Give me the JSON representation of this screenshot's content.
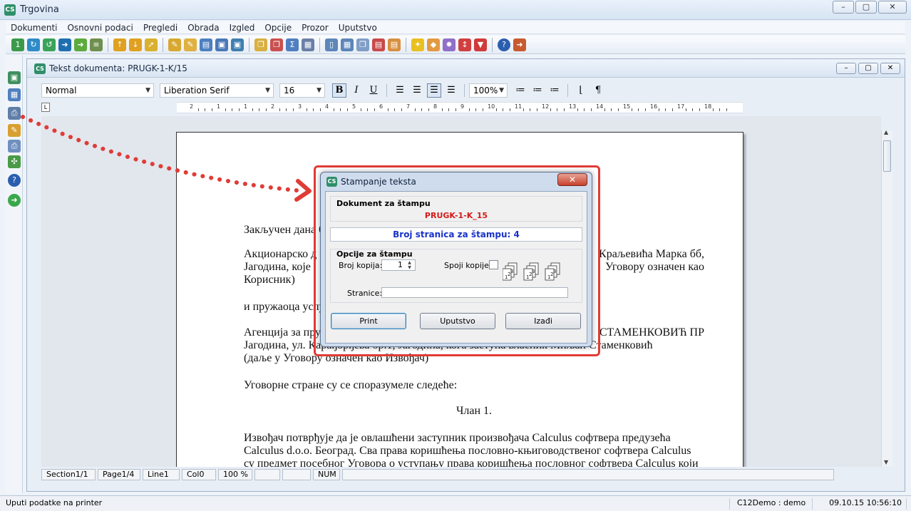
{
  "app": {
    "title": "Trgovina",
    "logo_text": "CS",
    "window_buttons": [
      "–",
      "▢",
      "✕"
    ]
  },
  "menu": [
    "Dokumenti",
    "Osnovni podaci",
    "Pregledi",
    "Obrada",
    "Izgled",
    "Opcije",
    "Prozor",
    "Uputstvo"
  ],
  "document_window": {
    "title": "Tekst dokumenta: PRUGK-1-K/15",
    "buttons": [
      "–",
      "▢",
      "✕"
    ]
  },
  "format_bar": {
    "style": "Normal",
    "font": "Liberation Serif",
    "size": "16",
    "zoom": "100%",
    "bold": "B",
    "italic": "I",
    "underline": "U",
    "paragraph_mark": "¶"
  },
  "ruler": {
    "tab_marker": "L",
    "labels": [
      "2",
      "1",
      "1",
      "2",
      "3",
      "4",
      "5",
      "6",
      "7",
      "8",
      "9",
      "10",
      "11",
      "12",
      "13",
      "14",
      "15",
      "16",
      "17",
      "18"
    ]
  },
  "document_text": {
    "line1": "Закључен дана 0",
    "para2": "Акционарско д                                                              Краљевића Марка бб, Јагодина, које                                                              Уговору означен као Корисник)",
    "para2_l1": "Акционарско д",
    "para2_r1": "Краљевића Марка бб,",
    "para2_l2": "Јагодина, које",
    "para2_r2": "Уговору означен као",
    "para2_l3": "Корисник)",
    "line3": "и пружаоца услу",
    "para4_l1": "Агенција за пру",
    "para4_r1": "СТАМЕНКОВИЋ ПР",
    "para4_l2": "Јагодина, ул. Карађорђева бр.1, Јагодина, кога заступа власник Миљан Стаменковић",
    "para4_l3": "(даље у Уговору означен као Извођач)",
    "line5": "Уговорне стране су се споразумеле следеће:",
    "article": "Члан 1.",
    "para6_l1": "Извођач потврђује да је овлашћени заступник произвођача Calculus софтвера предузећа",
    "para6_l2": "Calculus d.o.o. Београд. Сва права коришћења пословно-књиговодственог софтвера Calculus",
    "para6_l3": "су предмет посебног Уговора о уступању права коришћења пословног софтвера Calculus који"
  },
  "doc_status": {
    "section": "Section1/1",
    "page": "Page1/4",
    "line": "Line1",
    "col": "Col0",
    "zoom": "100 %",
    "num": "NUM"
  },
  "app_status": {
    "message": "Uputi podatke na printer",
    "user": "C12Demo : demo",
    "datetime": "09.10.15 10:56:10"
  },
  "dialog": {
    "title": "Stampanje teksta",
    "close": "✕",
    "doc_group_title": "Dokument za štampu",
    "doc_name": "PRUGK-1-K_15",
    "pages_label": "Broj stranica za štampu: 4",
    "options_title": "Opcije za štampu",
    "copies_label": "Broj kopija:",
    "copies_value": "1",
    "collate_label": "Spoji kopije:",
    "collate_checked": false,
    "pages_field_label": "Stranice:",
    "pages_field_value": "",
    "btn_print": "Print",
    "btn_help": "Uputstvo",
    "btn_exit": "Izađi"
  },
  "colors": {
    "annotation_red": "#e03c36",
    "doc_name_red": "#d41a1a",
    "pages_blue": "#1833c9"
  }
}
